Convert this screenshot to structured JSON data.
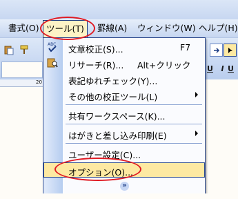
{
  "menubar": {
    "items": [
      {
        "label": "書式(O)"
      },
      {
        "label": "ツール(T)"
      },
      {
        "label": "罫線(A)"
      },
      {
        "label": "ウィンドウ(W)"
      },
      {
        "label": "ヘルプ(H)"
      }
    ],
    "active_index": 1
  },
  "toolbar_left": {
    "ruler_label": "20",
    "icons": [
      "paste-icon",
      "format-painter-icon"
    ]
  },
  "toolbar_right": {
    "buttons": [
      "U",
      "I",
      "U"
    ]
  },
  "tools_menu": {
    "items": [
      {
        "label": "文章校正(S)...",
        "accel": "F7",
        "icon": "spellcheck-icon"
      },
      {
        "label": "リサーチ(R)...",
        "accel": "Alt+クリック",
        "icon": "research-icon"
      },
      {
        "label": "表記ゆれチェック(Y)..."
      },
      {
        "label": "その他の校正ツール(L)",
        "submenu": true
      },
      {
        "label": "共有ワークスペース(K)..."
      },
      {
        "label": "はがきと差し込み印刷(E)",
        "submenu": true
      },
      {
        "label": "ユーザー設定(C)..."
      },
      {
        "label": "オプション(O)...",
        "highlighted": true
      }
    ],
    "expand_icon": "chevron-double-down-icon"
  },
  "colors": {
    "highlight_ellipse": "#e01b24",
    "menu_border": "#2d4a8e",
    "hover_fill": "#fde9a2"
  }
}
